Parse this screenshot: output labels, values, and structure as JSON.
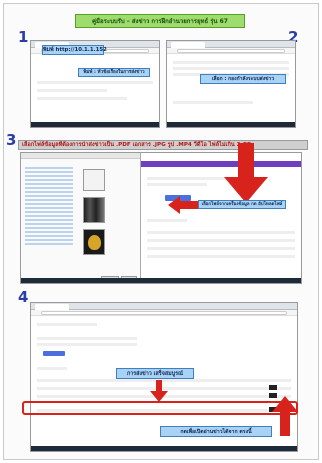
{
  "title": "คู่มือระบบรับ – ส่งข่าว การฝึกอำนวยการยุทธ์ รุ่น 67",
  "steps": {
    "one": "1",
    "two": "2",
    "three": "3",
    "four": "4"
  },
  "step1": {
    "url_callout": "พิมพ์ http://10.1.1.152",
    "tab_callout": "พิมพ์ : หัวข้อเรื่องในการส่งข่าว"
  },
  "step2": {
    "callout": "เลือก : กองกำลังระบบส่งข่าว"
  },
  "step3": {
    "banner": "เลือกไฟล์ข้อมูลที่ต้องการนำส่งข่าวเป็น .PDF เอกสาร .JPG รูป .MP4 วีดีโอ ไฟล์ไม่เกิน 2 GB",
    "upload_callout": "เลือกไฟล์จากเครื่องข้อมูล กด อัปโหลดไฟล์"
  },
  "step4": {
    "done_callout": "การส่งข่าว เสร็จสมบูรณ์",
    "open_callout": "กดเพื่อเปิดอ่านข่าวได้จาก ตรงนี้"
  },
  "colors": {
    "title_bg": "#9fdc6e",
    "step_number": "#2a3da8",
    "callout_bg": "#a9d3f5",
    "arrow_red": "#d8231c",
    "app_purple": "#6f3fbf"
  }
}
